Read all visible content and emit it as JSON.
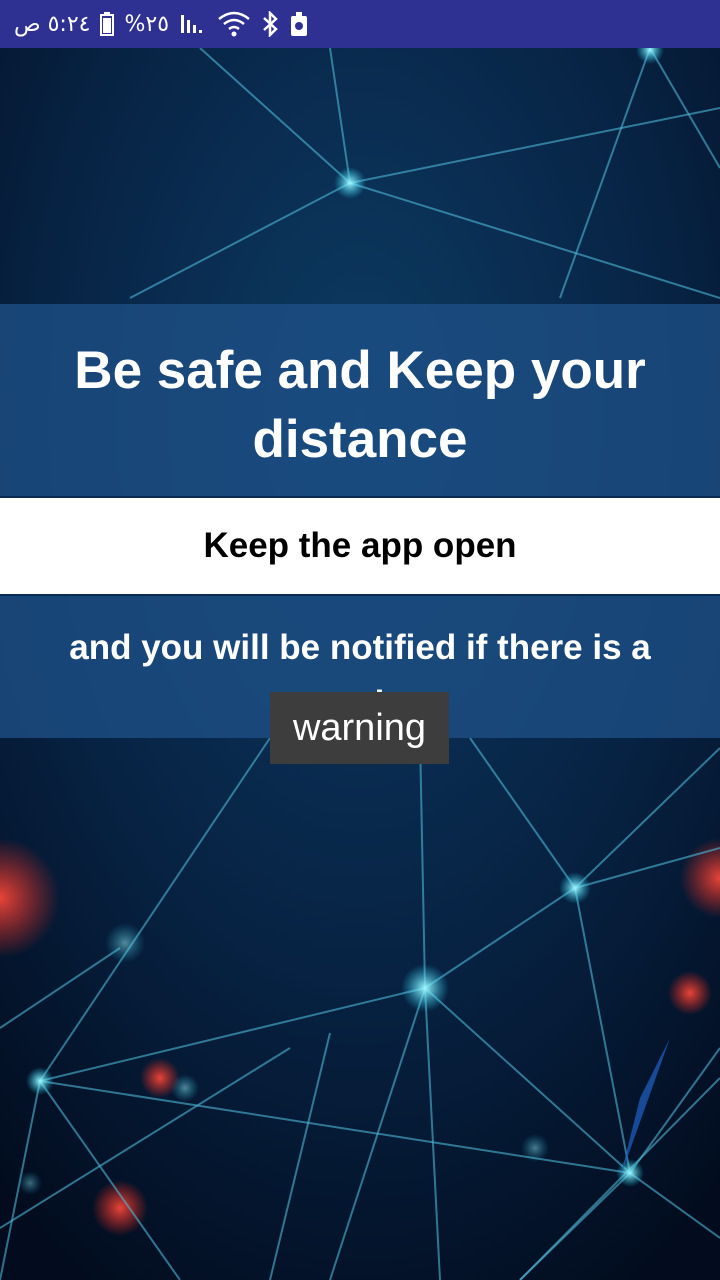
{
  "status_bar": {
    "time": "٥:٢٤ ص",
    "battery_percent": "%٢٥",
    "background_color": "#2e3192",
    "icons": [
      "battery-icon",
      "signal-icon",
      "wifi-icon",
      "bluetooth-icon",
      "notification-icon"
    ]
  },
  "main": {
    "headline": "Be safe and Keep your distance",
    "instruction": "Keep the app open",
    "notification_text": "and you will be notified if there is a warning"
  },
  "toast": {
    "text": "warning"
  }
}
